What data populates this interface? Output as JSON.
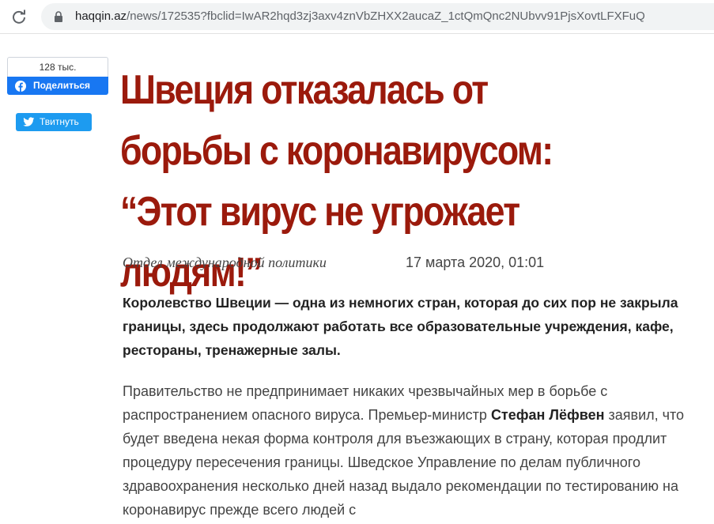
{
  "browser": {
    "url_host": "haqqin.az",
    "url_path": "/news/172535?fbclid=IwAR2hqd3zj3axv4znVbZHXX2aucaZ_1ctQmQnc2NUbvv91PjsXovtLFXFuQ"
  },
  "share": {
    "facebook_count": "128 тыс.",
    "facebook_label": "Поделиться",
    "twitter_label": "Твитнуть"
  },
  "article": {
    "headline": "Швеция отказалась от борьбы с коронавирусом: “Этот вирус не угрожает людям!”",
    "author": "Отдел международной политики",
    "date": "17 марта 2020, 01:01",
    "lead": "Королевство Швеции — одна из немногих стран, которая до сих пор не закрыла границы, здесь продолжают работать все образовательные учреждения, кафе, рестораны, тренажерные залы.",
    "body_part1": "Правительство не предпринимает никаких чрезвычайных мер в борьбе с распространением опасного вируса. Премьер-министр ",
    "body_bold": "Стефан Лёфвен",
    "body_part2": " заявил, что будет введена некая форма контроля для въезжающих в страну, которая продлит процедуру пересечения границы. Шведское Управление по делам публичного здравоохранения несколько дней назад выдало рекомендации по тестированию на коронавирус прежде всего людей с"
  },
  "colors": {
    "headline": "#9b1a0c",
    "facebook": "#1877f2",
    "twitter": "#1d9bf0"
  }
}
